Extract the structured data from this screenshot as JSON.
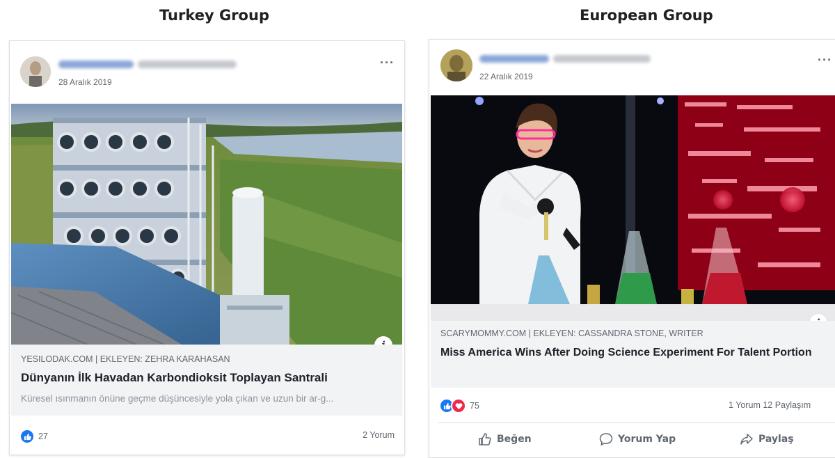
{
  "groups": {
    "left_title": "Turkey Group",
    "right_title": "European Group"
  },
  "left_post": {
    "date": "28 Aralık 2019",
    "more": "···",
    "link_domain": "YESILODAK.COM | EKLEYEN: ZEHRA KARAHASAN",
    "link_title": "Dünyanın İlk Havadan Karbondioksit Toplayan Santrali",
    "link_description": "Küresel ısınmanın önüne geçme düşüncesiyle yola çıkan ve uzun bir ar-g...",
    "info": "i",
    "reaction_count": "27",
    "comments": "2 Yorum"
  },
  "right_post": {
    "date": "22 Aralık 2019",
    "more": "···",
    "link_domain": "SCARYMOMMY.COM | EKLEYEN: CASSANDRA STONE, WRITER",
    "link_title": "Miss America Wins After Doing Science Experiment For Talent Portion",
    "info": "i",
    "reaction_count": "75",
    "comments": "1 Yorum  12 Paylaşım",
    "actions": {
      "like": "Beğen",
      "comment": "Yorum Yap",
      "share": "Paylaş"
    }
  },
  "colors": {
    "facebook_blue": "#1877f2",
    "love_red": "#f02849",
    "link_bg": "#f2f3f5"
  }
}
